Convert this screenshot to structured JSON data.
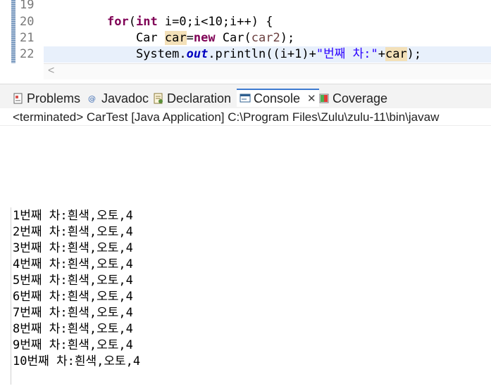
{
  "editor": {
    "lines": [
      {
        "number": "19",
        "text": ""
      },
      {
        "number": "20",
        "tokens": [
          [
            "kw",
            "for"
          ],
          [
            "var",
            "("
          ],
          [
            "kw",
            "int"
          ],
          [
            "var",
            " i=0;i<10;i++) {"
          ]
        ]
      },
      {
        "number": "21",
        "tokens": [
          [
            "var",
            "    Car "
          ],
          [
            "hl",
            "car"
          ],
          [
            "var",
            "="
          ],
          [
            "kw",
            "new"
          ],
          [
            "var",
            " Car("
          ],
          [
            "pl",
            "car2"
          ],
          [
            "var",
            ");"
          ]
        ]
      },
      {
        "number": "22",
        "tokens": [
          [
            "var",
            "    System."
          ],
          [
            "fld",
            "out"
          ],
          [
            "var",
            ".println((i+1)+"
          ],
          [
            "str",
            "\"번째 차:\""
          ],
          [
            "var",
            "+"
          ],
          [
            "hl",
            "car"
          ],
          [
            "var",
            ");"
          ]
        ]
      }
    ]
  },
  "tabs": [
    {
      "label": "Problems",
      "icon": "problems-icon"
    },
    {
      "label": "Javadoc",
      "icon": "javadoc-icon"
    },
    {
      "label": "Declaration",
      "icon": "declaration-icon"
    },
    {
      "label": "Console",
      "icon": "console-icon",
      "active": true
    },
    {
      "label": "Coverage",
      "icon": "coverage-icon"
    }
  ],
  "console": {
    "header": "<terminated> CarTest [Java Application] C:\\Program Files\\Zulu\\zulu-11\\bin\\javaw",
    "output": [
      "1번째 차:흰색,오토,4",
      "2번째 차:흰색,오토,4",
      "3번째 차:흰색,오토,4",
      "4번째 차:흰색,오토,4",
      "5번째 차:흰색,오토,4",
      "6번째 차:흰색,오토,4",
      "7번째 차:흰색,오토,4",
      "8번째 차:흰색,오토,4",
      "9번째 차:흰색,오토,4",
      "10번째 차:흰색,오토,4"
    ]
  },
  "colors": {
    "keyword": "#7f0055",
    "string": "#2a00ff",
    "field": "#0000c0",
    "active_tab": "#3f7bd1"
  }
}
